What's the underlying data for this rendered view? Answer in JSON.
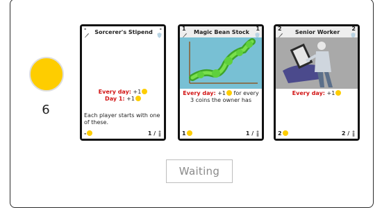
{
  "player": {
    "coins": "6"
  },
  "cards": [
    {
      "cost": "-",
      "title": "Sorcerer's Stipend",
      "power": "-",
      "effect_line1_label": "Every day:",
      "effect_line1_value": "+1",
      "effect_line2_label": "Day 1:",
      "effect_line2_value": "+1",
      "flavor": "Each player starts with one of these.",
      "foot_cost": "-",
      "foot_count": "1 /"
    },
    {
      "cost": "1",
      "title": "Magic Bean Stock",
      "power": "1",
      "effect_label": "Every day:",
      "effect_value": "+1",
      "effect_rest": "for every 3 coins the owner has",
      "foot_cost": "1",
      "foot_count": "1 /"
    },
    {
      "cost": "2",
      "title": "Senior Worker",
      "power": "2",
      "effect_label": "Every day:",
      "effect_value": "+1",
      "foot_cost": "2",
      "foot_count": "2 /"
    }
  ],
  "actions": {
    "waiting_label": "Waiting"
  },
  "colors": {
    "coin": "#fecd00",
    "effect_red": "#d21414",
    "bean_bg": "#78c0d4",
    "worker_bg": "#a9a9a9"
  }
}
